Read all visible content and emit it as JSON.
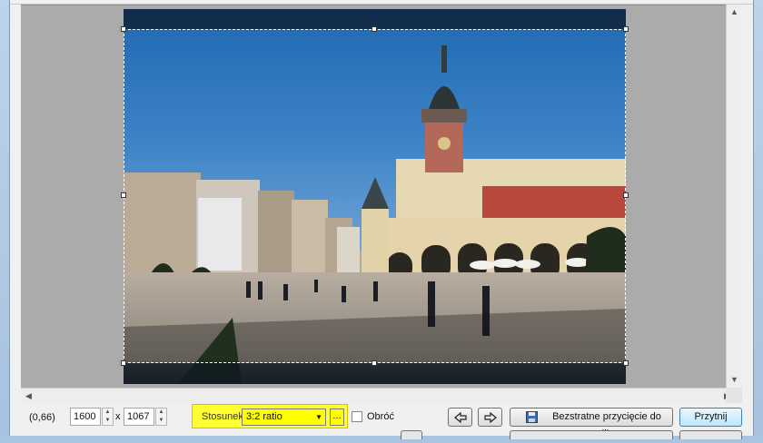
{
  "status": {
    "coords": "(0,66)"
  },
  "size": {
    "width": "1600",
    "height": "1067",
    "separator": "x"
  },
  "ratio": {
    "label": "Stosunek:",
    "value": "3:2 ratio",
    "more_label": "..."
  },
  "rotate": {
    "label": "Obróć",
    "checked": false
  },
  "buttons": {
    "lossless_crop": "Bezstratne przycięcie do pliku",
    "crop": "Przytnij"
  },
  "icons": {
    "prev": "arrow-left-icon",
    "next": "arrow-right-icon",
    "save": "floppy-disk-icon",
    "scroll_up": "chevron-up-icon",
    "scroll_down": "chevron-down-icon",
    "scroll_left": "chevron-left-icon",
    "scroll_right": "chevron-right-icon"
  },
  "colors": {
    "highlight": "#ffff33",
    "selection_border": "#ffffff",
    "accent": "#3c7fb1"
  }
}
